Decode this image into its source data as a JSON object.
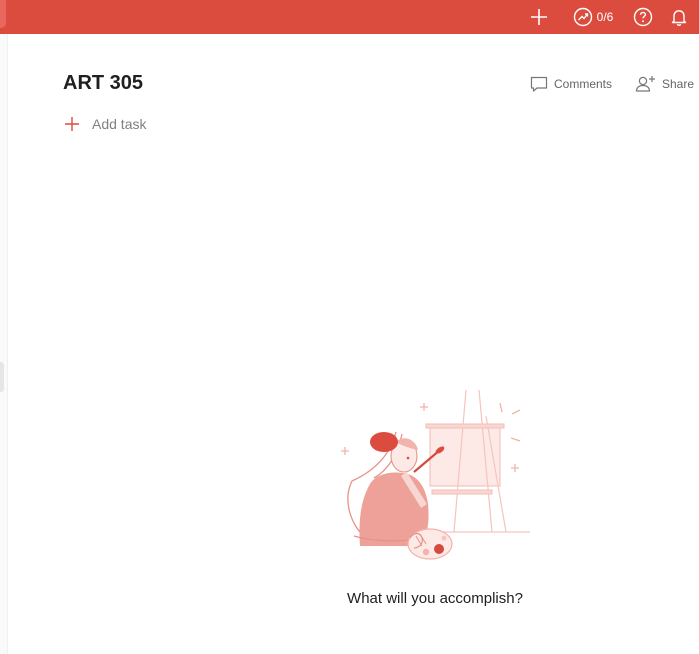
{
  "topbar": {
    "karma_label": "0/6",
    "icons": [
      "add-icon",
      "productivity-trend-icon",
      "help-icon",
      "notifications-bell-icon"
    ],
    "background": "#db4c3f"
  },
  "project": {
    "title": "ART 305"
  },
  "header_actions": {
    "comments_label": "Comments",
    "share_label": "Share"
  },
  "add_task": {
    "label": "Add task",
    "accent": "#db4c3f"
  },
  "empty_state": {
    "message": "What will you accomplish?",
    "illustration": "painter-at-easel-illustration"
  }
}
